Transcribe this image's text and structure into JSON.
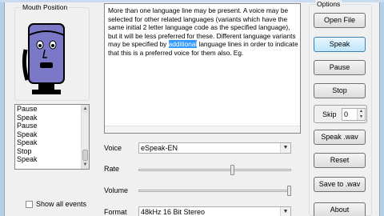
{
  "mouth_panel": {
    "title": "Mouth Position"
  },
  "log": {
    "items": [
      "Pause",
      "Speak",
      "Pause",
      "Speak",
      "Speak",
      "Stop",
      "Speak"
    ]
  },
  "show_all_events": {
    "label": "Show all events",
    "checked": false
  },
  "text": {
    "before": "More than one language line may be present. A voice may be selected for other related languages (variants which have the same initial 2 letter language code as the specified language), but it will be less preferred for these. Different language variants may be specified by ",
    "selected": "additional",
    "after": " language lines in order to indicate that this is a preferred voice for them also. Eg."
  },
  "voice": {
    "label": "Voice",
    "value": "eSpeak-EN"
  },
  "rate": {
    "label": "Rate",
    "level": 0.62
  },
  "volume": {
    "label": "Volume",
    "level": 1.0
  },
  "format": {
    "label": "Format",
    "value": "48kHz 16 Bit Stereo"
  },
  "options": {
    "title": "Options",
    "open_file": "Open File",
    "speak": "Speak",
    "pause": "Pause",
    "stop": "Stop",
    "skip_label": "Skip",
    "skip_value": "0",
    "speak_wav": "Speak .wav",
    "reset": "Reset",
    "save_to_wav": "Save to .wav",
    "about": "About"
  },
  "icons": {
    "arrow_up": "▲",
    "arrow_down": "▼"
  }
}
